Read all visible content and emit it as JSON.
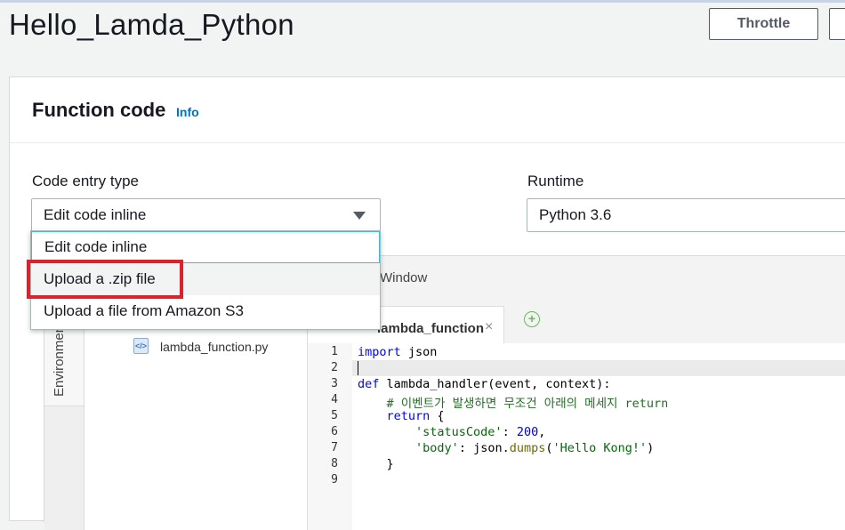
{
  "header": {
    "title": "Hello_Lamda_Python",
    "throttle_label": "Throttle"
  },
  "panel": {
    "title": "Function code",
    "info_label": "Info"
  },
  "code_entry": {
    "label": "Code entry type",
    "selected": "Edit code inline",
    "options": [
      "Edit code inline",
      "Upload a .zip file",
      "Upload a file from Amazon S3"
    ],
    "highlighted_option": "Upload a .zip file"
  },
  "runtime": {
    "label": "Runtime",
    "selected": "Python 3.6"
  },
  "ide": {
    "menu_window": "Window",
    "env_tab": "Environment",
    "file_name": "lambda_function.py",
    "tab_label": "lambda_function",
    "tab_close": "×",
    "tab_add": "+",
    "line_numbers": [
      "1",
      "2",
      "3",
      "4",
      "5",
      "6",
      "7",
      "8",
      "9"
    ],
    "code": {
      "l1_kw": "import",
      "l1_rest": " json",
      "l3_kw": "def",
      "l3_rest": " lambda_handler(event, context):",
      "l4_comment": "    # 이벤트가 발생하면 무조건 아래의 메세지 return",
      "l5_kw": "return",
      "l5_rest": " {",
      "l6_key": "'statusCode'",
      "l6_val": "200",
      "l7_key": "'body'",
      "l7_mid": ": json.",
      "l7_fn": "dumps",
      "l7_arg": "'Hello Kong!'",
      "l8": "    }"
    }
  },
  "colors": {
    "accent_link": "#0073bb",
    "highlight_red": "#d9232e",
    "focus_blue": "#44b9d6"
  }
}
